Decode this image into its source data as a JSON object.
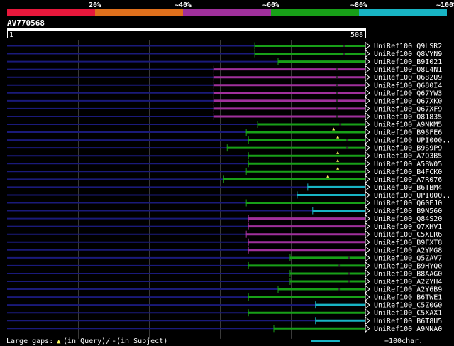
{
  "chart_data": {
    "type": "alignment-overview",
    "query_id": "AV770568",
    "query_length": 508,
    "scale_start": "1",
    "scale_end": "508",
    "identity_legend": [
      {
        "label": "",
        "color": "#e8183c"
      },
      {
        "label": "20%",
        "color": "#e0701c"
      },
      {
        "label": "~40%",
        "color": "#a0309c"
      },
      {
        "label": "~60%",
        "color": "#18a018"
      },
      {
        "label": "~80%",
        "color": "#18b4c4"
      },
      {
        "label": "~100%",
        "color": ""
      }
    ],
    "hits": [
      {
        "name": "UniRef100_Q9LSR2",
        "start": 351,
        "end": 508,
        "color": "green",
        "gaps_query": [],
        "gaps_subject": [
          477
        ]
      },
      {
        "name": "UniRef100_Q8VYN9",
        "start": 351,
        "end": 508,
        "color": "green",
        "gaps_query": [],
        "gaps_subject": [
          477
        ]
      },
      {
        "name": "UniRef100_B9I021",
        "start": 384,
        "end": 508,
        "color": "green",
        "gaps_query": [],
        "gaps_subject": []
      },
      {
        "name": "UniRef100_Q8L4N1",
        "start": 293,
        "end": 508,
        "color": "purple",
        "gaps_query": [],
        "gaps_subject": [
          467
        ]
      },
      {
        "name": "UniRef100_Q682U9",
        "start": 293,
        "end": 508,
        "color": "purple",
        "gaps_query": [],
        "gaps_subject": [
          467
        ]
      },
      {
        "name": "UniRef100_Q680I4",
        "start": 293,
        "end": 508,
        "color": "purple",
        "gaps_query": [],
        "gaps_subject": [
          467
        ]
      },
      {
        "name": "UniRef100_Q67YW3",
        "start": 293,
        "end": 508,
        "color": "purple",
        "gaps_query": [],
        "gaps_subject": [
          467
        ]
      },
      {
        "name": "UniRef100_Q67XK0",
        "start": 293,
        "end": 508,
        "color": "purple",
        "gaps_query": [],
        "gaps_subject": [
          467
        ]
      },
      {
        "name": "UniRef100_Q67XF9",
        "start": 293,
        "end": 508,
        "color": "purple",
        "gaps_query": [],
        "gaps_subject": [
          467
        ]
      },
      {
        "name": "UniRef100_O81835",
        "start": 293,
        "end": 508,
        "color": "purple",
        "gaps_query": [],
        "gaps_subject": [
          467
        ]
      },
      {
        "name": "UniRef100_A9NKM5",
        "start": 355,
        "end": 508,
        "color": "green",
        "gaps_query": [],
        "gaps_subject": [
          472
        ]
      },
      {
        "name": "UniRef100_B9SFE6",
        "start": 339,
        "end": 508,
        "color": "green",
        "gaps_query": [
          463
        ],
        "gaps_subject": []
      },
      {
        "name": "UniRef100_UPI000..",
        "start": 342,
        "end": 508,
        "color": "green",
        "gaps_query": [
          469
        ],
        "gaps_subject": [
          482
        ]
      },
      {
        "name": "UniRef100_B9S9P9",
        "start": 312,
        "end": 508,
        "color": "green",
        "gaps_query": [],
        "gaps_subject": [
          482
        ]
      },
      {
        "name": "UniRef100_A7Q3B5",
        "start": 342,
        "end": 508,
        "color": "green",
        "gaps_query": [
          469
        ],
        "gaps_subject": []
      },
      {
        "name": "UniRef100_A5BW05",
        "start": 342,
        "end": 508,
        "color": "green",
        "gaps_query": [
          469
        ],
        "gaps_subject": []
      },
      {
        "name": "UniRef100_B4FCK0",
        "start": 339,
        "end": 508,
        "color": "green",
        "gaps_query": [
          469
        ],
        "gaps_subject": []
      },
      {
        "name": "UniRef100_A7R076",
        "start": 307,
        "end": 508,
        "color": "green",
        "gaps_query": [
          455
        ],
        "gaps_subject": []
      },
      {
        "name": "UniRef100_B6TBM4",
        "start": 426,
        "end": 508,
        "color": "cyan",
        "gaps_query": [],
        "gaps_subject": []
      },
      {
        "name": "UniRef100_UPI000..",
        "start": 411,
        "end": 508,
        "color": "cyan",
        "gaps_query": [],
        "gaps_subject": []
      },
      {
        "name": "UniRef100_Q60EJ0",
        "start": 339,
        "end": 508,
        "color": "green",
        "gaps_query": [],
        "gaps_subject": []
      },
      {
        "name": "UniRef100_B9N560",
        "start": 433,
        "end": 508,
        "color": "cyan",
        "gaps_query": [],
        "gaps_subject": []
      },
      {
        "name": "UniRef100_Q84S20",
        "start": 342,
        "end": 508,
        "color": "purple",
        "gaps_query": [],
        "gaps_subject": []
      },
      {
        "name": "UniRef100_Q7XHV1",
        "start": 342,
        "end": 508,
        "color": "purple",
        "gaps_query": [],
        "gaps_subject": []
      },
      {
        "name": "UniRef100_C5XLR6",
        "start": 339,
        "end": 508,
        "color": "purple",
        "gaps_query": [],
        "gaps_subject": []
      },
      {
        "name": "UniRef100_B9FXT8",
        "start": 342,
        "end": 508,
        "color": "purple",
        "gaps_query": [],
        "gaps_subject": []
      },
      {
        "name": "UniRef100_A2YMG8",
        "start": 342,
        "end": 508,
        "color": "purple",
        "gaps_query": [],
        "gaps_subject": []
      },
      {
        "name": "UniRef100_Q5ZAV7",
        "start": 401,
        "end": 508,
        "color": "green",
        "gaps_query": [],
        "gaps_subject": [
          484
        ]
      },
      {
        "name": "UniRef100_B9HYQ0",
        "start": 342,
        "end": 508,
        "color": "green",
        "gaps_query": [],
        "gaps_subject": [
          471
        ]
      },
      {
        "name": "UniRef100_B8AAG0",
        "start": 401,
        "end": 508,
        "color": "green",
        "gaps_query": [],
        "gaps_subject": [
          484
        ]
      },
      {
        "name": "UniRef100_A2ZYH4",
        "start": 401,
        "end": 508,
        "color": "green",
        "gaps_query": [],
        "gaps_subject": [
          484
        ]
      },
      {
        "name": "UniRef100_A2Y6B9",
        "start": 384,
        "end": 508,
        "color": "green",
        "gaps_query": [],
        "gaps_subject": [
          471
        ]
      },
      {
        "name": "UniRef100_B6TWE1",
        "start": 342,
        "end": 508,
        "color": "green",
        "gaps_query": [],
        "gaps_subject": []
      },
      {
        "name": "UniRef100_C5Z0G0",
        "start": 437,
        "end": 508,
        "color": "cyan",
        "gaps_query": [],
        "gaps_subject": []
      },
      {
        "name": "UniRef100_C5XAX1",
        "start": 342,
        "end": 508,
        "color": "green",
        "gaps_query": [],
        "gaps_subject": []
      },
      {
        "name": "UniRef100_B6T8U5",
        "start": 437,
        "end": 508,
        "color": "cyan",
        "gaps_query": [],
        "gaps_subject": []
      },
      {
        "name": "UniRef100_A9NNA0",
        "start": 378,
        "end": 508,
        "color": "green",
        "gaps_query": [],
        "gaps_subject": []
      }
    ],
    "footer": {
      "gaps_label": "Large gaps: ",
      "gaps_query_symbol": "▲",
      "gaps_query_text": "(in Query)/",
      "gaps_subject_symbol": "-",
      "gaps_subject_text": " (in Subject)",
      "scale_label": "=100char.",
      "scale_chars": 100
    },
    "colors": {
      "background": "#000000",
      "red": "#e8183c",
      "orange": "#e0701c",
      "purple": "#a0309c",
      "green": "#18a018",
      "cyan": "#18b4c4",
      "unaligned_line": "#1a1a7a",
      "grid": "#3a3a3a",
      "query_bar": "#ffffff",
      "gap_marker": "#ffff60",
      "text": "#ffffff"
    }
  }
}
